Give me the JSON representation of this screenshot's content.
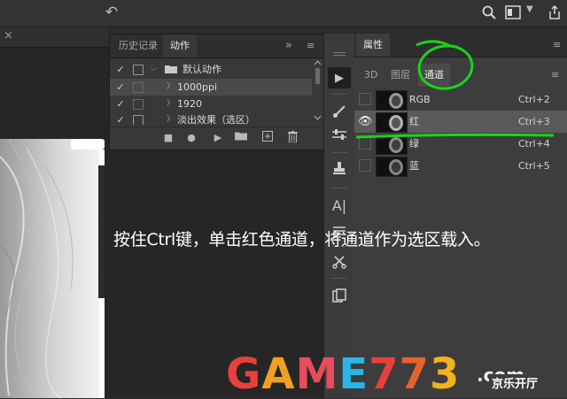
{
  "topbar": {
    "icons": [
      "undo-icon",
      "search-icon",
      "workspace-icon",
      "chevron-down-icon",
      "share-icon"
    ]
  },
  "document": {
    "close_glyph": "×"
  },
  "actions_panel": {
    "tabs": [
      "历史记录",
      "动作"
    ],
    "active_tab": "动作",
    "menu_glyph": "»",
    "rows": [
      {
        "checked": "✓",
        "label": "默认动作",
        "type": "set"
      },
      {
        "checked": "✓",
        "label": "1000ppi",
        "type": "action"
      },
      {
        "checked": "✓",
        "label": "1920",
        "type": "action"
      },
      {
        "checked": "✓",
        "label": "淡出效果（选区）",
        "type": "action"
      }
    ],
    "bottom_buttons": [
      "stop-icon",
      "record-icon",
      "play-icon",
      "new-set-icon",
      "new-action-icon",
      "trash-icon"
    ]
  },
  "tools": [
    "play-icon",
    "brush-icon",
    "adjust-icon",
    "stamp-icon",
    "text-icon",
    "cut-icon",
    "copy-icon"
  ],
  "properties_panel": {
    "title": "属性",
    "subtabs": [
      "3D",
      "图层",
      "通道"
    ],
    "active_subtab": "通道",
    "channels": [
      {
        "name": "RGB",
        "shortcut": "Ctrl+2",
        "visible": false,
        "selected": false
      },
      {
        "name": "红",
        "shortcut": "Ctrl+3",
        "visible": true,
        "selected": true
      },
      {
        "name": "绿",
        "shortcut": "Ctrl+4",
        "visible": false,
        "selected": false
      },
      {
        "name": "蓝",
        "shortcut": "Ctrl+5",
        "visible": false,
        "selected": false
      }
    ]
  },
  "caption": "按住Ctrl键，单击红色通道，将通道作为选区载入。",
  "annotation_color": "#17d617",
  "watermark": {
    "text": "GAME773",
    "suffix": ".com",
    "cn": "京乐开厅",
    "colors": [
      "#e8413c",
      "#f0a020",
      "#e84c5a",
      "#29b7e8",
      "#e8413c",
      "#e6632a",
      "#f2b21e"
    ]
  }
}
